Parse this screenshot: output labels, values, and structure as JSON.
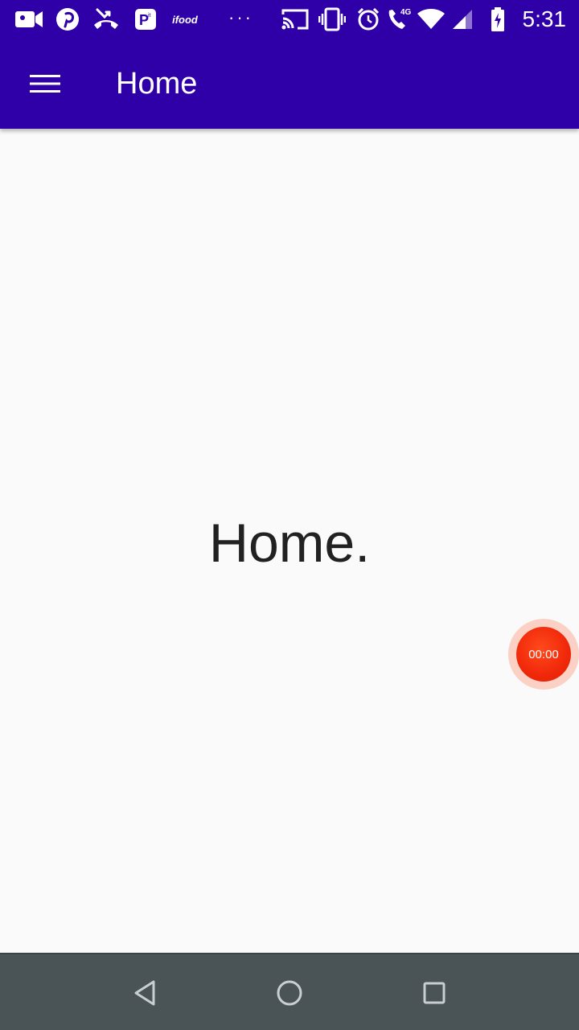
{
  "status_bar": {
    "time": "5:31",
    "network_label": "4G",
    "ifood_label": "ifood",
    "overflow_dots": "···",
    "left_icons": [
      "video-camera-icon",
      "pinterest-icon",
      "missed-call-icon",
      "parking-app-icon",
      "ifood-icon",
      "more-notifications-icon"
    ],
    "right_icons": [
      "cast-icon",
      "vibrate-icon",
      "alarm-icon",
      "wifi-calling-icon",
      "wifi-icon",
      "cellular-signal-icon",
      "battery-charging-icon"
    ]
  },
  "app_bar": {
    "title": "Home",
    "menu_icon": "hamburger-menu-icon",
    "background": "#2f00a8"
  },
  "content": {
    "main_text": "Home."
  },
  "recorder": {
    "timer": "00:00",
    "color": "#f0280a"
  },
  "nav_bar": {
    "buttons": [
      "back-icon",
      "home-icon",
      "recents-icon"
    ],
    "background": "#4a5356"
  }
}
